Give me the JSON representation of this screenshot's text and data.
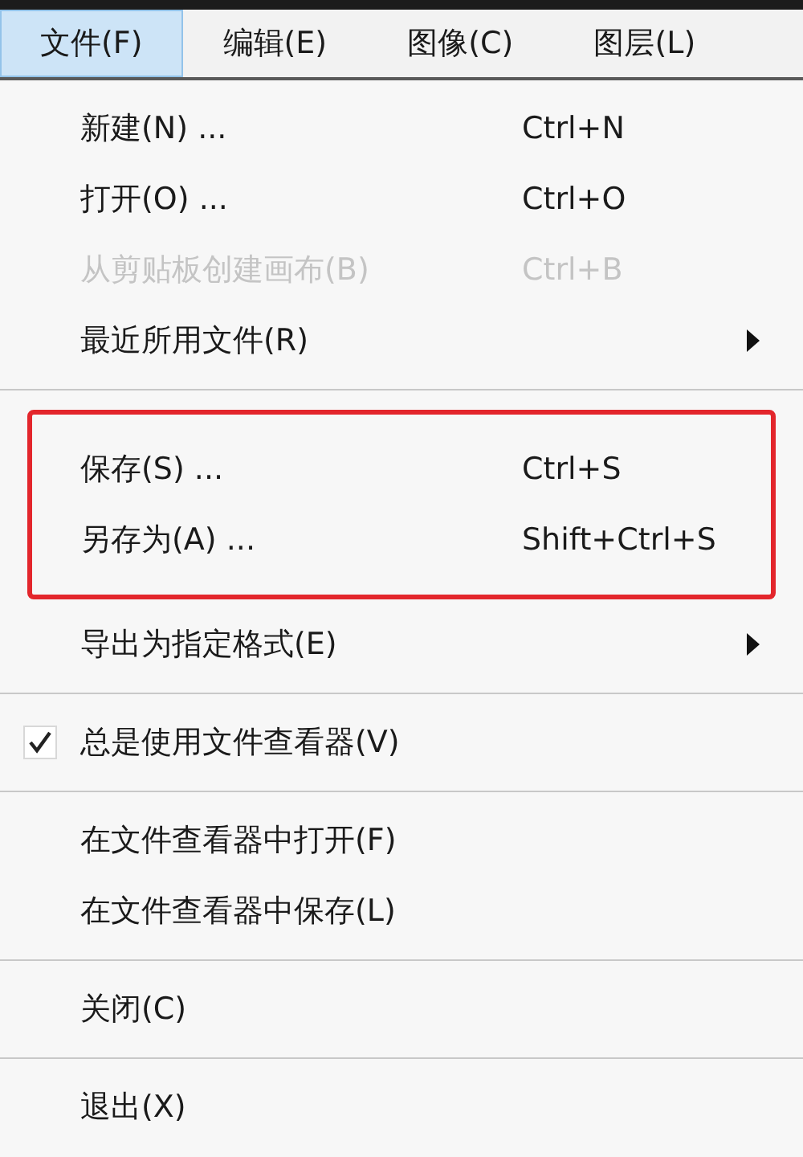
{
  "menu_bar": [
    {
      "label": "文件(F)",
      "selected": true
    },
    {
      "label": "编辑(E)",
      "selected": false
    },
    {
      "label": "图像(C)",
      "selected": false
    },
    {
      "label": "图层(L)",
      "selected": false
    }
  ],
  "menu": {
    "sections": [
      {
        "blocks": [
          {
            "highlighted": false,
            "items": [
              {
                "kind": "command",
                "label": "新建(N) ...",
                "shortcut": "Ctrl+N",
                "disabled": false,
                "submenu": false
              },
              {
                "kind": "command",
                "label": "打开(O) ...",
                "shortcut": "Ctrl+O",
                "disabled": false,
                "submenu": false
              },
              {
                "kind": "command",
                "label": "从剪贴板创建画布(B)",
                "shortcut": "Ctrl+B",
                "disabled": true,
                "submenu": false
              },
              {
                "kind": "command",
                "label": "最近所用文件(R)",
                "disabled": false,
                "submenu": true
              }
            ]
          }
        ]
      },
      {
        "blocks": [
          {
            "highlighted": true,
            "items": [
              {
                "kind": "command",
                "label": "保存(S) ...",
                "shortcut": "Ctrl+S",
                "disabled": false,
                "submenu": false
              },
              {
                "kind": "command",
                "label": "另存为(A) ...",
                "shortcut": "Shift+Ctrl+S",
                "disabled": false,
                "submenu": false
              }
            ]
          },
          {
            "highlighted": false,
            "items": [
              {
                "kind": "command",
                "label": "导出为指定格式(E)",
                "disabled": false,
                "submenu": true
              }
            ]
          }
        ]
      },
      {
        "blocks": [
          {
            "highlighted": false,
            "items": [
              {
                "kind": "check",
                "label": "总是使用文件查看器(V)",
                "checked": true,
                "disabled": false,
                "submenu": false
              }
            ]
          }
        ]
      },
      {
        "blocks": [
          {
            "highlighted": false,
            "items": [
              {
                "kind": "command",
                "label": "在文件查看器中打开(F)",
                "disabled": false,
                "submenu": false
              },
              {
                "kind": "command",
                "label": "在文件查看器中保存(L)",
                "disabled": false,
                "submenu": false
              }
            ]
          }
        ]
      },
      {
        "blocks": [
          {
            "highlighted": false,
            "items": [
              {
                "kind": "command",
                "label": "关闭(C)",
                "disabled": false,
                "submenu": false
              }
            ]
          }
        ]
      },
      {
        "blocks": [
          {
            "highlighted": false,
            "items": [
              {
                "kind": "command",
                "label": "退出(X)",
                "disabled": false,
                "submenu": false
              }
            ]
          }
        ]
      }
    ]
  }
}
